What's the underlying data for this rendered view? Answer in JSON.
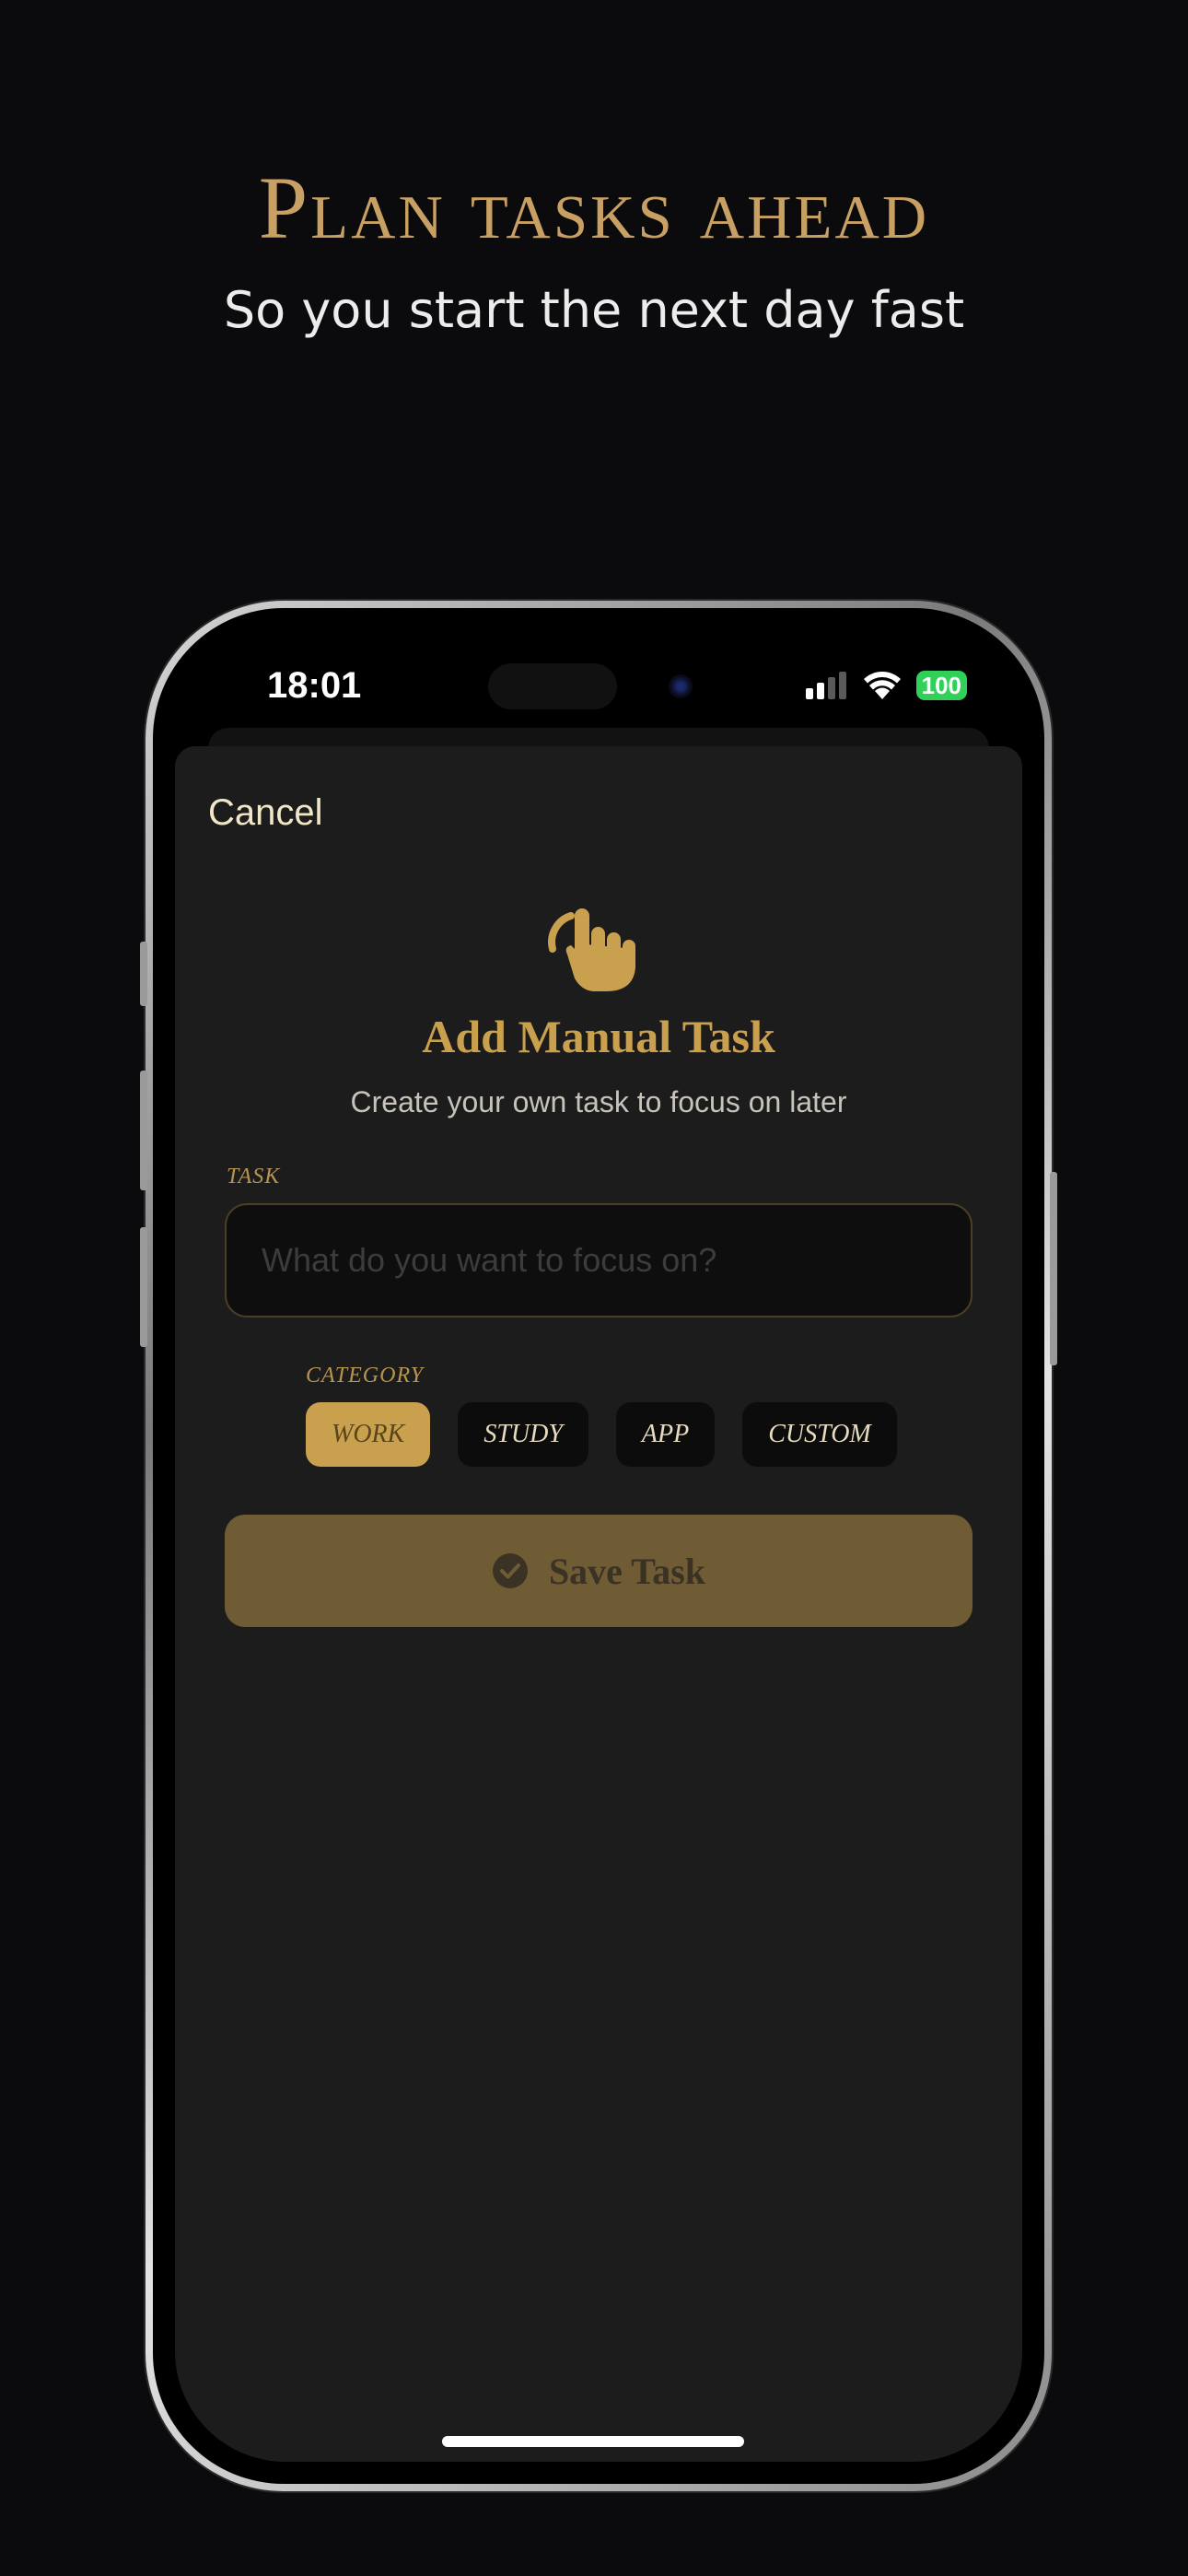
{
  "marketing": {
    "headline": "Plan tasks ahead",
    "subheadline": "So you start the next day fast"
  },
  "status_bar": {
    "time": "18:01",
    "battery": "100",
    "icons": [
      "cellular-signal-icon",
      "wifi-icon",
      "battery-icon"
    ]
  },
  "sheet": {
    "cancel_label": "Cancel",
    "icon": "tap-hand-icon",
    "title": "Add Manual Task",
    "subtitle": "Create your own task to focus on later",
    "task_label": "TASK",
    "task_value": "",
    "task_placeholder": "What do you want to focus on?",
    "category_label": "CATEGORY",
    "categories": [
      {
        "label": "WORK",
        "selected": true
      },
      {
        "label": "STUDY",
        "selected": false
      },
      {
        "label": "APP",
        "selected": false
      },
      {
        "label": "CUSTOM",
        "selected": false
      }
    ],
    "save_label": "Save Task"
  },
  "colors": {
    "background": "#0b0b0d",
    "accent_gold": "#c9a04e",
    "sheet_bg": "#1c1c1c",
    "battery_green": "#2fd158"
  }
}
